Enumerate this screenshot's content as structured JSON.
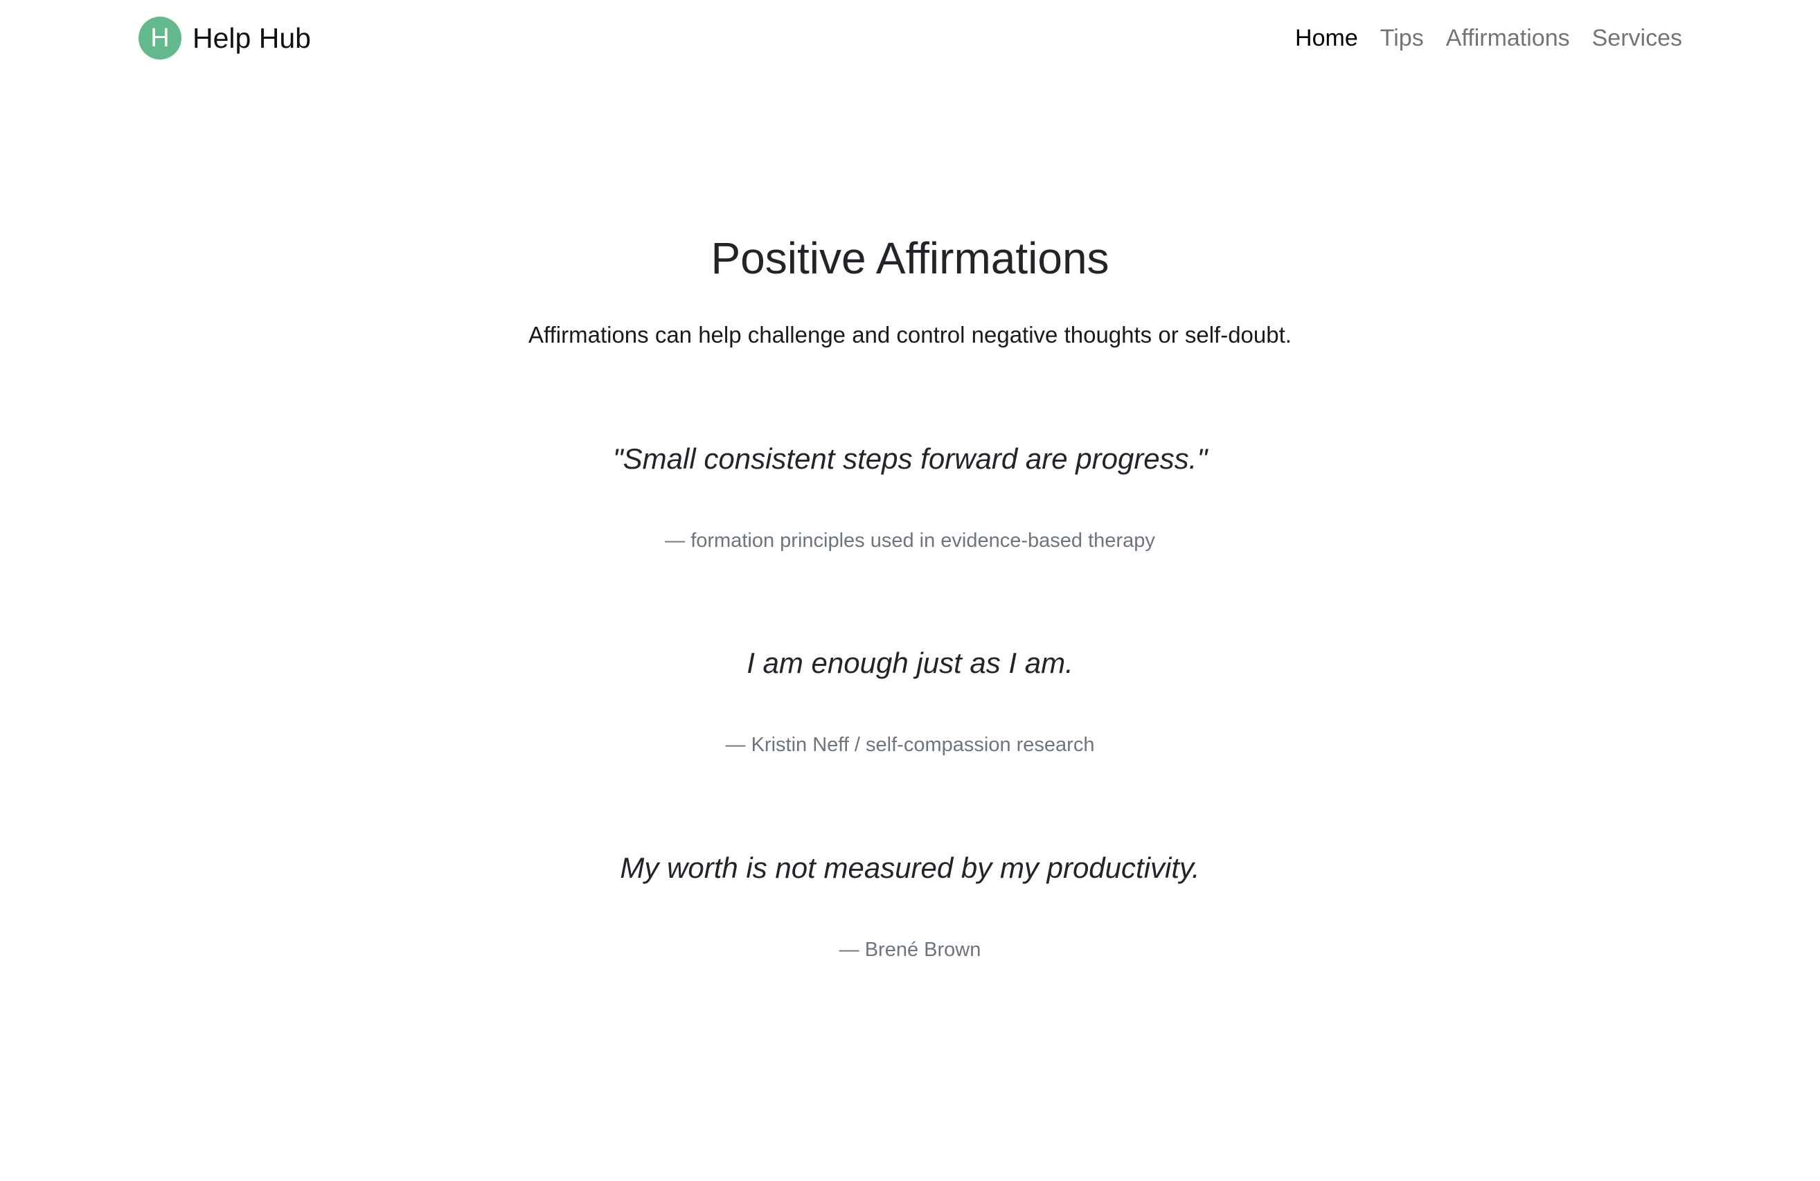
{
  "brand": {
    "logo_letter": "H",
    "name": "Help Hub",
    "logo_color": "#63b98c"
  },
  "nav": {
    "items": [
      {
        "label": "Home",
        "active": true
      },
      {
        "label": "Tips",
        "active": false
      },
      {
        "label": "Affirmations",
        "active": false
      },
      {
        "label": "Services",
        "active": false
      }
    ]
  },
  "page": {
    "title": "Positive Affirmations",
    "lead": "Affirmations can help challenge and control negative thoughts or self-doubt."
  },
  "affirmations": [
    {
      "text": "\"Small consistent steps forward are progress.\"",
      "attribution": "— formation principles used in evidence-based therapy"
    },
    {
      "text": "I am enough just as I am.",
      "attribution": "— Kristin Neff / self-compassion research"
    },
    {
      "text": "My worth is not measured by my productivity.",
      "attribution": "— Brené Brown"
    }
  ]
}
